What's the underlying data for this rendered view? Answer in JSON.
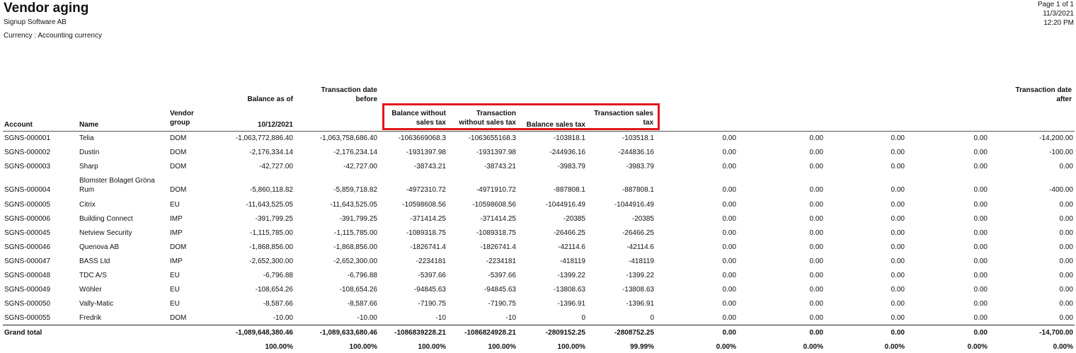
{
  "header": {
    "title": "Vendor aging",
    "company": "Signup Software AB",
    "currency": "Currency : Accounting currency",
    "page": "Page 1 of 1",
    "date": "11/3/2021",
    "time": "12:20 PM"
  },
  "columns": {
    "account": "Account",
    "name": "Name",
    "vendor_group": "Vendor group",
    "balance_as_of_label": "Balance as of",
    "balance_as_of_date": "10/12/2021",
    "txn_date_before": "Transaction date before",
    "balance_without_tax": "Balance without sales tax",
    "txn_without_tax": "Transaction without sales tax",
    "balance_sales_tax": "Balance sales tax",
    "txn_sales_tax": "Transaction sales tax",
    "txn_date_after": "Transaction date after"
  },
  "rows": [
    {
      "account": "SGNS-000001",
      "name": "Telia",
      "group": "DOM",
      "c": [
        "-1,063,772,886.40",
        "-1,063,758,686.40",
        "-1063669068.3",
        "-1063655168.3",
        "-103818.1",
        "-103518.1",
        "0.00",
        "0.00",
        "0.00",
        "0.00",
        "-14,200.00"
      ]
    },
    {
      "account": "SGNS-000002",
      "name": "Dustin",
      "group": "DOM",
      "c": [
        "-2,176,334.14",
        "-2,176,234.14",
        "-1931397.98",
        "-1931397.98",
        "-244936.16",
        "-244836.16",
        "0.00",
        "0.00",
        "0.00",
        "0.00",
        "-100.00"
      ]
    },
    {
      "account": "SGNS-000003",
      "name": "Sharp",
      "group": "DOM",
      "c": [
        "-42,727.00",
        "-42,727.00",
        "-38743.21",
        "-38743.21",
        "-3983.79",
        "-3983.79",
        "0.00",
        "0.00",
        "0.00",
        "0.00",
        "0.00"
      ]
    },
    {
      "account": "SGNS-000004",
      "name": "Blomster Bolaget Gröna Rum",
      "group": "DOM",
      "c": [
        "-5,860,118.82",
        "-5,859,718.82",
        "-4972310.72",
        "-4971910.72",
        "-887808.1",
        "-887808.1",
        "0.00",
        "0.00",
        "0.00",
        "0.00",
        "-400.00"
      ]
    },
    {
      "account": "SGNS-000005",
      "name": "Citrix",
      "group": "EU",
      "c": [
        "-11,643,525.05",
        "-11,643,525.05",
        "-10598608.56",
        "-10598608.56",
        "-1044916.49",
        "-1044916.49",
        "0.00",
        "0.00",
        "0.00",
        "0.00",
        "0.00"
      ]
    },
    {
      "account": "SGNS-000006",
      "name": "Building Connect",
      "group": "IMP",
      "c": [
        "-391,799.25",
        "-391,799.25",
        "-371414.25",
        "-371414.25",
        "-20385",
        "-20385",
        "0.00",
        "0.00",
        "0.00",
        "0.00",
        "0.00"
      ]
    },
    {
      "account": "SGNS-000045",
      "name": "Netview Security",
      "group": "IMP",
      "c": [
        "-1,115,785.00",
        "-1,115,785.00",
        "-1089318.75",
        "-1089318.75",
        "-26466.25",
        "-26466.25",
        "0.00",
        "0.00",
        "0.00",
        "0.00",
        "0.00"
      ]
    },
    {
      "account": "SGNS-000046",
      "name": "Quenova AB",
      "group": "DOM",
      "c": [
        "-1,868,856.00",
        "-1,868,856.00",
        "-1826741.4",
        "-1826741.4",
        "-42114.6",
        "-42114.6",
        "0.00",
        "0.00",
        "0.00",
        "0.00",
        "0.00"
      ]
    },
    {
      "account": "SGNS-000047",
      "name": "BASS Ltd",
      "group": "IMP",
      "c": [
        "-2,652,300.00",
        "-2,652,300.00",
        "-2234181",
        "-2234181",
        "-418119",
        "-418119",
        "0.00",
        "0.00",
        "0.00",
        "0.00",
        "0.00"
      ]
    },
    {
      "account": "SGNS-000048",
      "name": "TDC A/S",
      "group": "EU",
      "c": [
        "-6,796.88",
        "-6,796.88",
        "-5397.66",
        "-5397.66",
        "-1399.22",
        "-1399.22",
        "0.00",
        "0.00",
        "0.00",
        "0.00",
        "0.00"
      ]
    },
    {
      "account": "SGNS-000049",
      "name": "Wöhler",
      "group": "EU",
      "c": [
        "-108,654.26",
        "-108,654.26",
        "-94845.63",
        "-94845.63",
        "-13808.63",
        "-13808.63",
        "0.00",
        "0.00",
        "0.00",
        "0.00",
        "0.00"
      ]
    },
    {
      "account": "SGNS-000050",
      "name": "Vally-Matic",
      "group": "EU",
      "c": [
        "-8,587.66",
        "-8,587.66",
        "-7190.75",
        "-7190.75",
        "-1396.91",
        "-1396.91",
        "0.00",
        "0.00",
        "0.00",
        "0.00",
        "0.00"
      ]
    },
    {
      "account": "SGNS-000055",
      "name": "Fredrik",
      "group": "DOM",
      "c": [
        "-10.00",
        "-10.00",
        "-10",
        "-10",
        "0",
        "0",
        "0.00",
        "0.00",
        "0.00",
        "0.00",
        "0.00"
      ]
    }
  ],
  "grand_total": {
    "label": "Grand total",
    "c": [
      "-1,089,648,380.46",
      "-1,089,633,680.46",
      "-1086839228.21",
      "-1086824928.21",
      "-2809152.25",
      "-2808752.25",
      "0.00",
      "0.00",
      "0.00",
      "0.00",
      "-14,700.00"
    ]
  },
  "percent_row": {
    "c": [
      "100.00%",
      "100.00%",
      "100.00%",
      "100.00%",
      "100.00%",
      "99.99%",
      "0.00%",
      "0.00%",
      "0.00%",
      "0.00%",
      "0.00%"
    ]
  },
  "highlight_color": "#e3161b"
}
